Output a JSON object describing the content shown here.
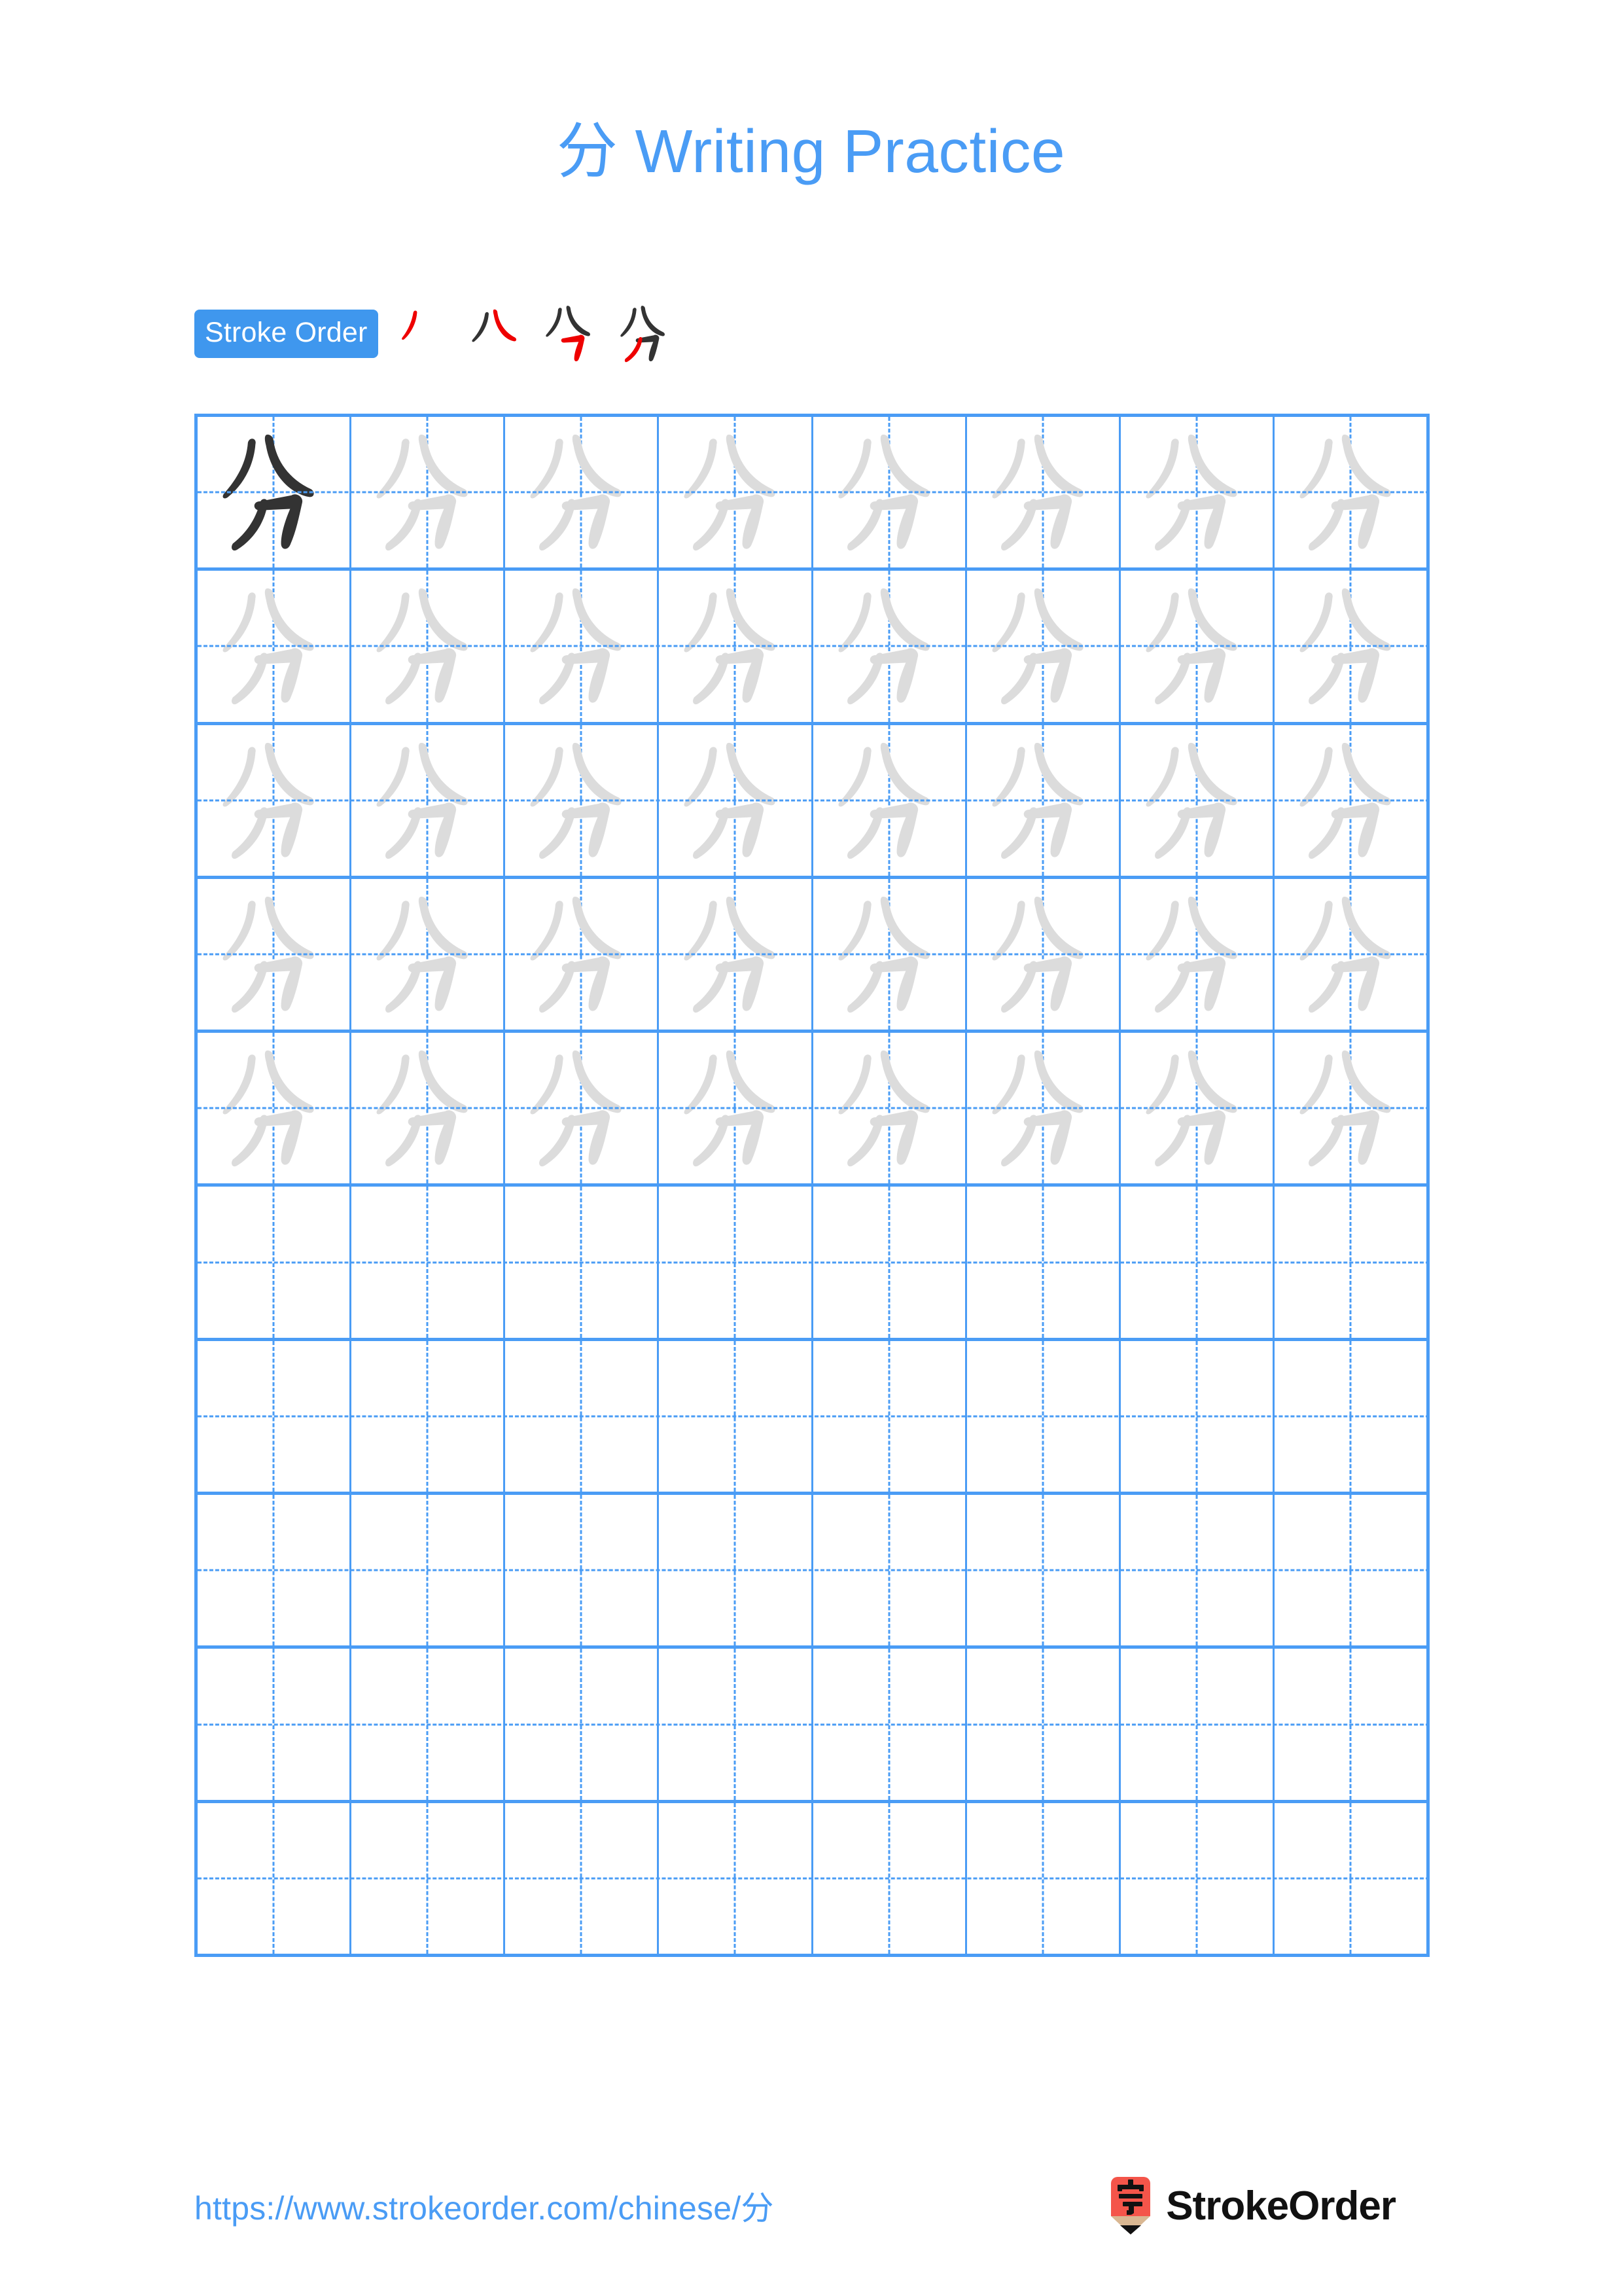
{
  "page": {
    "title": "分 Writing Practice",
    "character": "分",
    "background_color": "#ffffff",
    "accent_color": "#4a9cf5",
    "grid_line_color": "#4a9cf5",
    "trace_glyph_color": "#dcdcdc",
    "model_glyph_color": "#333333",
    "highlight_stroke_color": "#ee0000"
  },
  "stroke_order": {
    "label": "Stroke Order",
    "badge_background": "#3f97ee",
    "badge_text_color": "#ffffff",
    "total_strokes": 4,
    "steps": [
      {
        "index": 1,
        "strokes_shown": 1,
        "new_stroke_color": "#ee0000",
        "prior_stroke_color": "#333333",
        "name": "stroke-step-1"
      },
      {
        "index": 2,
        "strokes_shown": 2,
        "new_stroke_color": "#ee0000",
        "prior_stroke_color": "#333333",
        "name": "stroke-step-2"
      },
      {
        "index": 3,
        "strokes_shown": 3,
        "new_stroke_color": "#ee0000",
        "prior_stroke_color": "#333333",
        "name": "stroke-step-3"
      },
      {
        "index": 4,
        "strokes_shown": 4,
        "new_stroke_color": "#ee0000",
        "prior_stroke_color": "#333333",
        "name": "stroke-step-4"
      }
    ]
  },
  "grid": {
    "columns": 8,
    "rows": 10,
    "filled_rows": 5,
    "empty_rows": 5,
    "rows_data": [
      [
        "model",
        "trace",
        "trace",
        "trace",
        "trace",
        "trace",
        "trace",
        "trace"
      ],
      [
        "trace",
        "trace",
        "trace",
        "trace",
        "trace",
        "trace",
        "trace",
        "trace"
      ],
      [
        "trace",
        "trace",
        "trace",
        "trace",
        "trace",
        "trace",
        "trace",
        "trace"
      ],
      [
        "trace",
        "trace",
        "trace",
        "trace",
        "trace",
        "trace",
        "trace",
        "trace"
      ],
      [
        "trace",
        "trace",
        "trace",
        "trace",
        "trace",
        "trace",
        "trace",
        "trace"
      ],
      [
        "empty",
        "empty",
        "empty",
        "empty",
        "empty",
        "empty",
        "empty",
        "empty"
      ],
      [
        "empty",
        "empty",
        "empty",
        "empty",
        "empty",
        "empty",
        "empty",
        "empty"
      ],
      [
        "empty",
        "empty",
        "empty",
        "empty",
        "empty",
        "empty",
        "empty",
        "empty"
      ],
      [
        "empty",
        "empty",
        "empty",
        "empty",
        "empty",
        "empty",
        "empty",
        "empty"
      ],
      [
        "empty",
        "empty",
        "empty",
        "empty",
        "empty",
        "empty",
        "empty",
        "empty"
      ]
    ]
  },
  "footer": {
    "url": "https://www.strokeorder.com/chinese/分",
    "brand_name": "StrokeOrder",
    "brand_mark_character": "字",
    "brand_mark_body_color": "#f4554a",
    "brand_mark_wood_color": "#d9b792",
    "brand_mark_tip_color": "#111111"
  }
}
